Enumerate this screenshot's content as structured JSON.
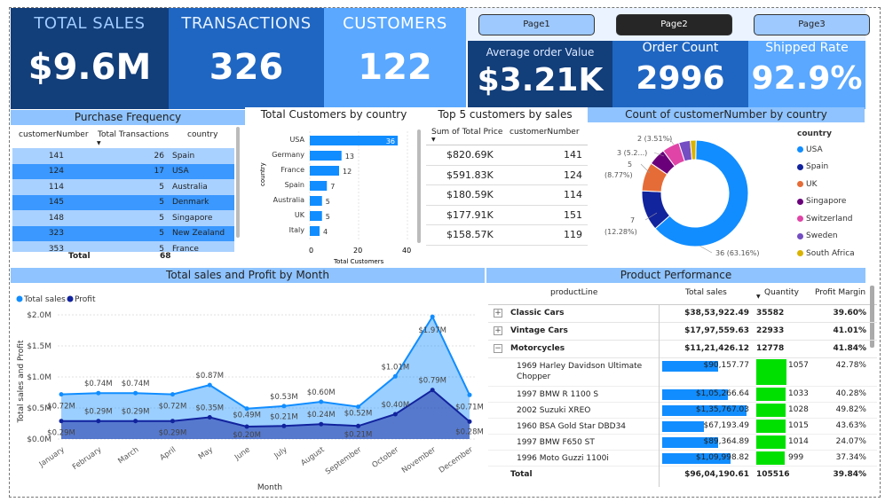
{
  "kpis": {
    "total_sales": {
      "label": "TOTAL SALES",
      "value": "$9.6M"
    },
    "transactions": {
      "label": "TRANSACTIONS",
      "value": "326"
    },
    "customers": {
      "label": "CUSTOMERS",
      "value": "122"
    },
    "avg_order": {
      "label": "Average order Value",
      "value": "$3.21K"
    },
    "order_count": {
      "label": "Order Count",
      "value": "2996"
    },
    "shipped_rate": {
      "label": "Shipped Rate",
      "value": "92.9%"
    }
  },
  "pages": [
    "Page1",
    "Page2",
    "Page3"
  ],
  "purchase_frequency": {
    "title": "Purchase Frequency",
    "headers": [
      "customerNumber",
      "Total Transactions",
      "country"
    ],
    "rows": [
      [
        "141",
        "26",
        "Spain"
      ],
      [
        "124",
        "17",
        "USA"
      ],
      [
        "114",
        "5",
        "Australia"
      ],
      [
        "145",
        "5",
        "Denmark"
      ],
      [
        "148",
        "5",
        "Singapore"
      ],
      [
        "323",
        "5",
        "New Zealand"
      ],
      [
        "353",
        "5",
        "France"
      ]
    ],
    "total_label": "Total",
    "total_value": "68"
  },
  "customers_by_country": {
    "title": "Total Customers by country",
    "ylabel": "country",
    "xlabel": "Total Customers",
    "ticks": [
      "0",
      "20",
      "40"
    ]
  },
  "top5": {
    "title": "Top 5 customers by sales",
    "headers": [
      "Sum of Total Price",
      "customerNumber"
    ],
    "rows": [
      [
        "$820.69K",
        "141"
      ],
      [
        "$591.83K",
        "124"
      ],
      [
        "$180.59K",
        "114"
      ],
      [
        "$177.91K",
        "151"
      ],
      [
        "$158.57K",
        "119"
      ]
    ]
  },
  "donut": {
    "title": "Count of customerNumber by country",
    "legend_title": "country",
    "labels": [
      "2 (3.51%)",
      "3 (5.2...)",
      "5",
      "(8.77%)",
      "7",
      "(12.28%)",
      "36 (63.16%)"
    ]
  },
  "line_chart": {
    "title": "Total sales and Profit by Month",
    "legend": [
      "Total sales",
      "Profit"
    ],
    "ylabel": "Total sales and Profit",
    "xlabel": "Month",
    "yticks": [
      "$2.0M",
      "$1.5M",
      "$1.0M",
      "$0.5M",
      "$0.0M"
    ],
    "sales_labels": [
      "$0.72M",
      "$0.74M",
      "$0.74M",
      "$0.72M",
      "$0.87M",
      "$0.49M",
      "$0.53M",
      "$0.60M",
      "$0.52M",
      "$1.01M",
      "$1.97M",
      "$0.71M"
    ],
    "profit_labels": [
      "$0.29M",
      "$0.29M",
      "$0.29M",
      "$0.29M",
      "$0.35M",
      "$0.20M",
      "$0.21M",
      "$0.24M",
      "$0.21M",
      "$0.40M",
      "$0.79M",
      "$0.28M"
    ]
  },
  "product_performance": {
    "title": "Product Performance",
    "headers": [
      "productLine",
      "Total sales",
      "Quantity",
      "Profit Margin"
    ],
    "groups": [
      {
        "name": "Classic Cars",
        "sales": "$38,53,922.49",
        "qty": "35582",
        "margin": "39.60%",
        "icon": "+"
      },
      {
        "name": "Vintage Cars",
        "sales": "$17,97,559.63",
        "qty": "22933",
        "margin": "41.01%",
        "icon": "+"
      },
      {
        "name": "Motorcycles",
        "sales": "$11,21,426.12",
        "qty": "12778",
        "margin": "41.84%",
        "icon": "−"
      }
    ],
    "rows": [
      {
        "name": "1969 Harley Davidson Ultimate Chopper",
        "sales": "$90,157.77",
        "qty": "1057",
        "margin": "42.78%"
      },
      {
        "name": "1997 BMW R 1100 S",
        "sales": "$1,05,266.64",
        "qty": "1033",
        "margin": "40.28%"
      },
      {
        "name": "2002 Suzuki XREO",
        "sales": "$1,35,767.03",
        "qty": "1028",
        "margin": "49.82%"
      },
      {
        "name": "1960 BSA Gold Star DBD34",
        "sales": "$67,193.49",
        "qty": "1015",
        "margin": "43.63%"
      },
      {
        "name": "1997 BMW F650 ST",
        "sales": "$89,364.89",
        "qty": "1014",
        "margin": "24.07%"
      },
      {
        "name": "1996 Moto Guzzi 1100i",
        "sales": "$1,09,998.82",
        "qty": "999",
        "margin": "37.34%"
      }
    ],
    "total_label": "Total",
    "total_sales": "$96,04,190.61",
    "total_qty": "105516",
    "total_margin": "39.84%"
  },
  "chart_data": [
    {
      "type": "bar",
      "title": "Total Customers by country",
      "xlabel": "Total Customers",
      "ylabel": "country",
      "categories": [
        "USA",
        "Germany",
        "France",
        "Spain",
        "Australia",
        "UK",
        "Italy"
      ],
      "values": [
        36,
        13,
        12,
        7,
        5,
        5,
        4
      ],
      "xlim": [
        0,
        40
      ]
    },
    {
      "type": "pie",
      "title": "Count of customerNumber by country",
      "categories": [
        "USA",
        "Spain",
        "UK",
        "Singapore",
        "Switzerland",
        "Sweden",
        "South Africa"
      ],
      "values": [
        36,
        7,
        5,
        3,
        3,
        2,
        1
      ],
      "colors": [
        "#118dff",
        "#12239e",
        "#e66c37",
        "#6b007b",
        "#e044a7",
        "#744ec2",
        "#d9b300"
      ]
    },
    {
      "type": "area",
      "title": "Total sales and Profit by Month",
      "xlabel": "Month",
      "ylabel": "Total sales and Profit",
      "categories": [
        "January",
        "February",
        "March",
        "April",
        "May",
        "June",
        "July",
        "August",
        "September",
        "October",
        "November",
        "December"
      ],
      "series": [
        {
          "name": "Total sales",
          "values": [
            0.72,
            0.74,
            0.74,
            0.72,
            0.87,
            0.49,
            0.53,
            0.6,
            0.52,
            1.01,
            1.97,
            0.71
          ],
          "color": "#118dff"
        },
        {
          "name": "Profit",
          "values": [
            0.29,
            0.29,
            0.29,
            0.29,
            0.35,
            0.2,
            0.21,
            0.24,
            0.21,
            0.4,
            0.79,
            0.28
          ],
          "color": "#12239e"
        }
      ],
      "ylim": [
        0,
        2.0
      ]
    },
    {
      "type": "table",
      "title": "Product Performance",
      "bar_values": [
        90157.77,
        105266.64,
        135767.03,
        67193.49,
        89364.89,
        109998.82
      ],
      "qty_values": [
        1057,
        1033,
        1028,
        1015,
        1014,
        999
      ]
    }
  ],
  "colors": {
    "dark_blue": "#123e7a",
    "mid_blue": "#1f66c2",
    "light_blue": "#5aa8ff",
    "title_bar": "#8ec3ff",
    "green": "#00e000"
  }
}
